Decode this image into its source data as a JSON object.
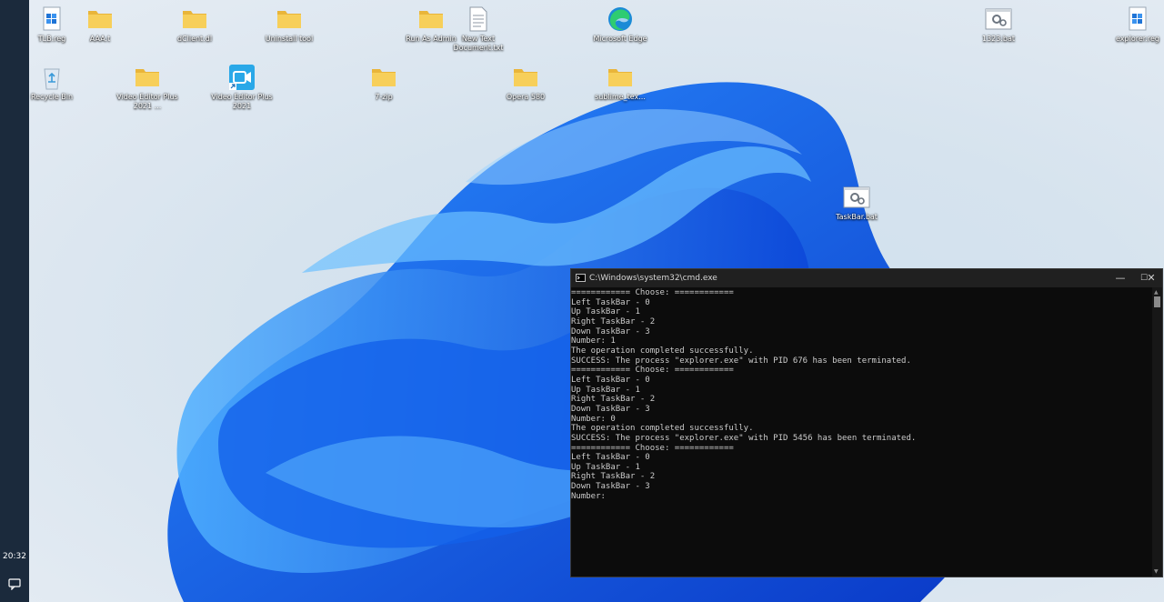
{
  "taskbar": {
    "clock": "20:32",
    "notification_icon": "notification-icon"
  },
  "desktop_icons": [
    {
      "label": "TLB.reg",
      "icon": "reg-file-icon"
    },
    {
      "label": "AAA.t",
      "icon": "folder-icon"
    },
    {
      "label": "dClient.dl",
      "icon": "folder-icon"
    },
    {
      "label": "Uninstall tool",
      "icon": "folder-icon"
    },
    {
      "label": "Run As Admin",
      "icon": "folder-icon"
    },
    {
      "label": "New Text Document.txt",
      "icon": "text-file-icon"
    },
    {
      "label": "Microsoft Edge",
      "icon": "edge-icon"
    },
    {
      "label": "1323.bat",
      "icon": "bat-file-icon"
    },
    {
      "label": "explorer.reg",
      "icon": "reg-file-icon"
    },
    {
      "label": "Recycle Bin",
      "icon": "recycle-bin-icon"
    },
    {
      "label": "Video Editor Plus 2021 ...",
      "icon": "folder-icon"
    },
    {
      "label": "Video Editor Plus 2021",
      "icon": "video-editor-icon"
    },
    {
      "label": "7-zip",
      "icon": "folder-icon"
    },
    {
      "label": "Opera 580",
      "icon": "folder-icon"
    },
    {
      "label": "sublime_tex...",
      "icon": "folder-icon"
    },
    {
      "label": "TaskBar.bat",
      "icon": "bat-file-icon"
    }
  ],
  "cmd": {
    "title": "C:\\Windows\\system32\\cmd.exe",
    "minimize": "—",
    "maximize": "☐",
    "close": "✕",
    "lines": [
      "============ Choose: ============",
      "Left TaskBar - 0",
      "Up TaskBar - 1",
      "Right TaskBar - 2",
      "Down TaskBar - 3",
      "Number: 1",
      "The operation completed successfully.",
      "SUCCESS: The process \"explorer.exe\" with PID 676 has been terminated.",
      "============ Choose: ============",
      "Left TaskBar - 0",
      "Up TaskBar - 1",
      "Right TaskBar - 2",
      "Down TaskBar - 3",
      "Number: 0",
      "The operation completed successfully.",
      "SUCCESS: The process \"explorer.exe\" with PID 5456 has been terminated.",
      "============ Choose: ============",
      "Left TaskBar - 0",
      "Up TaskBar - 1",
      "Right TaskBar - 2",
      "Down TaskBar - 3",
      "Number:"
    ]
  },
  "colors": {
    "taskbar": "#1b2a3c",
    "console_bg": "#0c0c0c",
    "console_text": "#cccccc",
    "folder": "#f4c84a",
    "bloom_dark": "#0b3fd0",
    "bloom_light": "#3aa0ff"
  }
}
